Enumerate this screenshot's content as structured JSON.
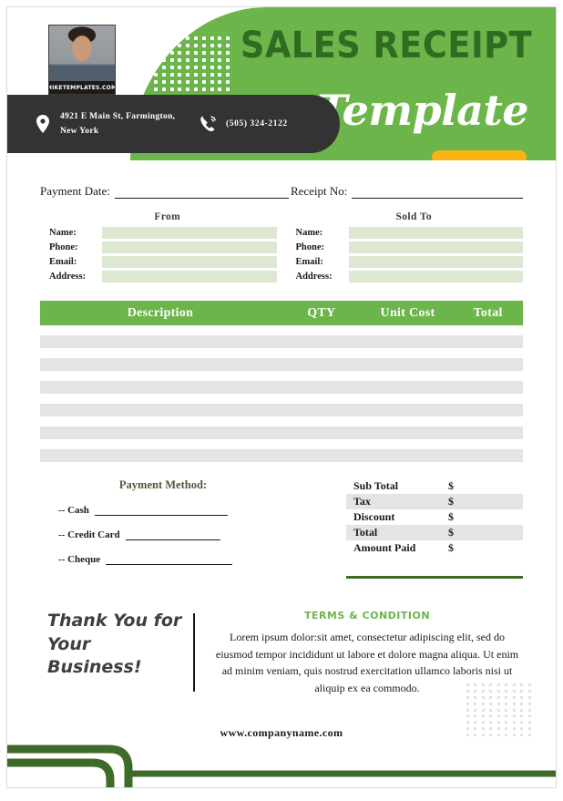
{
  "document": {
    "title_main": "SALES RECEIPT",
    "title_script": "Template"
  },
  "header": {
    "logo_caption": "HIKETEMPLATES.COM",
    "location_icon": "location-pin-icon",
    "phone_icon": "phone-icon",
    "address": "4921 E Main St, Farmington, New York",
    "phone": "(505) 324-2122"
  },
  "meta": {
    "payment_date_label": "Payment Date:",
    "payment_date_value": "",
    "receipt_no_label": "Receipt No:",
    "receipt_no_value": ""
  },
  "parties": [
    {
      "title": "From",
      "fields": [
        {
          "label": "Name:",
          "value": ""
        },
        {
          "label": "Phone:",
          "value": ""
        },
        {
          "label": "Email:",
          "value": ""
        },
        {
          "label": "Address:",
          "value": ""
        }
      ]
    },
    {
      "title": "Sold To",
      "fields": [
        {
          "label": "Name:",
          "value": ""
        },
        {
          "label": "Phone:",
          "value": ""
        },
        {
          "label": "Email:",
          "value": ""
        },
        {
          "label": "Address:",
          "value": ""
        }
      ]
    }
  ],
  "items_table": {
    "columns": [
      "Description",
      "QTY",
      "Unit Cost",
      "Total"
    ],
    "rows": [
      {
        "description": "",
        "qty": "",
        "unit_cost": "",
        "total": ""
      },
      {
        "description": "",
        "qty": "",
        "unit_cost": "",
        "total": ""
      },
      {
        "description": "",
        "qty": "",
        "unit_cost": "",
        "total": ""
      },
      {
        "description": "",
        "qty": "",
        "unit_cost": "",
        "total": ""
      },
      {
        "description": "",
        "qty": "",
        "unit_cost": "",
        "total": ""
      },
      {
        "description": "",
        "qty": "",
        "unit_cost": "",
        "total": ""
      }
    ]
  },
  "payment_method": {
    "title": "Payment Method:",
    "options": [
      {
        "label": "-- Cash",
        "value": ""
      },
      {
        "label": "-- Credit Card",
        "value": ""
      },
      {
        "label": "-- Cheque",
        "value": ""
      }
    ]
  },
  "totals": [
    {
      "name": "Sub Total",
      "currency": "$",
      "value": ""
    },
    {
      "name": "Tax",
      "currency": "$",
      "value": ""
    },
    {
      "name": "Discount",
      "currency": "$",
      "value": ""
    },
    {
      "name": "Total",
      "currency": "$",
      "value": ""
    },
    {
      "name": "Amount Paid",
      "currency": "$",
      "value": ""
    }
  ],
  "footer": {
    "thanks": "Thank You for Your Business!",
    "terms_title": "TERMS & CONDITION",
    "terms_body": "Lorem ipsum dolor:sit amet, consectetur adipiscing elit, sed do eiusmod tempor incididunt ut labore et dolore magna aliqua. Ut enim ad minim veniam, quis nostrud exercitation ullamco laboris nisi ut aliquip ex ea commodo.",
    "website": "www.companyname.com"
  },
  "colors": {
    "brand_green": "#6cb54a",
    "dark_green": "#2f6b20",
    "footer_green": "#3f6b28",
    "accent_yellow": "#f9b515",
    "dark_bar": "#333333",
    "field_green": "#dce8d2",
    "row_gray": "#e4e4e4"
  }
}
